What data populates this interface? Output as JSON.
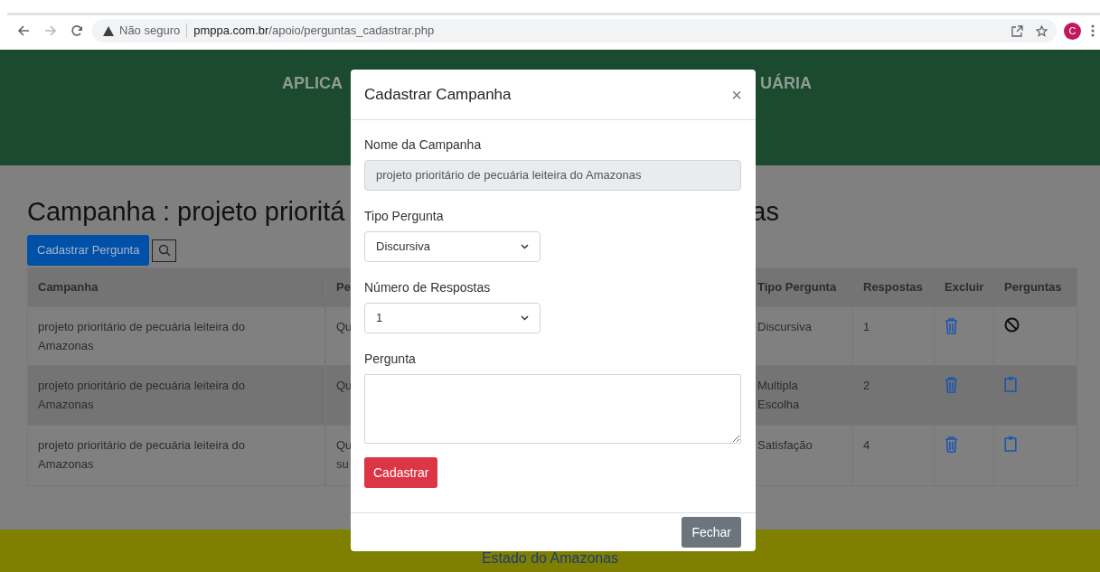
{
  "browser": {
    "security": "Não seguro",
    "url_host": "pmppa.com.br",
    "url_path": "/apoio/perguntas_cadastrar.php",
    "avatar": "C"
  },
  "header": {
    "title_left": "APLICA",
    "title_right": "UÁRIA"
  },
  "page": {
    "heading_left": "Campanha : projeto prioritá",
    "heading_right": "as",
    "add_button": "Cadastrar Pergunta"
  },
  "table": {
    "columns": [
      "Campanha",
      "Pe",
      "Tipo Pergunta",
      "Respostas",
      "Excluir",
      "Perguntas"
    ],
    "rows": [
      {
        "campanha": "projeto prioritário de pecuária leiteira do Amazonas",
        "column_2": [
          "Qu"
        ],
        "tipo": "Discursiva",
        "respostas": "1",
        "kind": "blocked"
      },
      {
        "campanha": "projeto prioritário de pecuária leiteira do Amazonas",
        "column_2": [
          "Qu"
        ],
        "tipo": "Multipla Escolha",
        "respostas": "2",
        "kind": "clipboard"
      },
      {
        "campanha": "projeto prioritário de pecuária leiteira do Amazonas",
        "column_2": [
          "Qu",
          "su"
        ],
        "tipo": "Satisfação",
        "respostas": "4",
        "kind": "clipboard"
      }
    ]
  },
  "modal": {
    "title": "Cadastrar Campanha",
    "close": "×",
    "fields": [
      {
        "kind": "readonly",
        "label": "Nome da Campanha",
        "value": "projeto prioritário de pecuária leiteira do Amazonas"
      },
      {
        "kind": "select",
        "label": "Tipo Pergunta",
        "value": "Discursiva"
      },
      {
        "kind": "select",
        "label": "Número de Respostas",
        "value": "1"
      },
      {
        "kind": "textarea",
        "label": "Pergunta"
      }
    ],
    "submit": "Cadastrar",
    "dismiss": "Fechar"
  },
  "footer": {
    "text": "Estado do Amazonas"
  }
}
